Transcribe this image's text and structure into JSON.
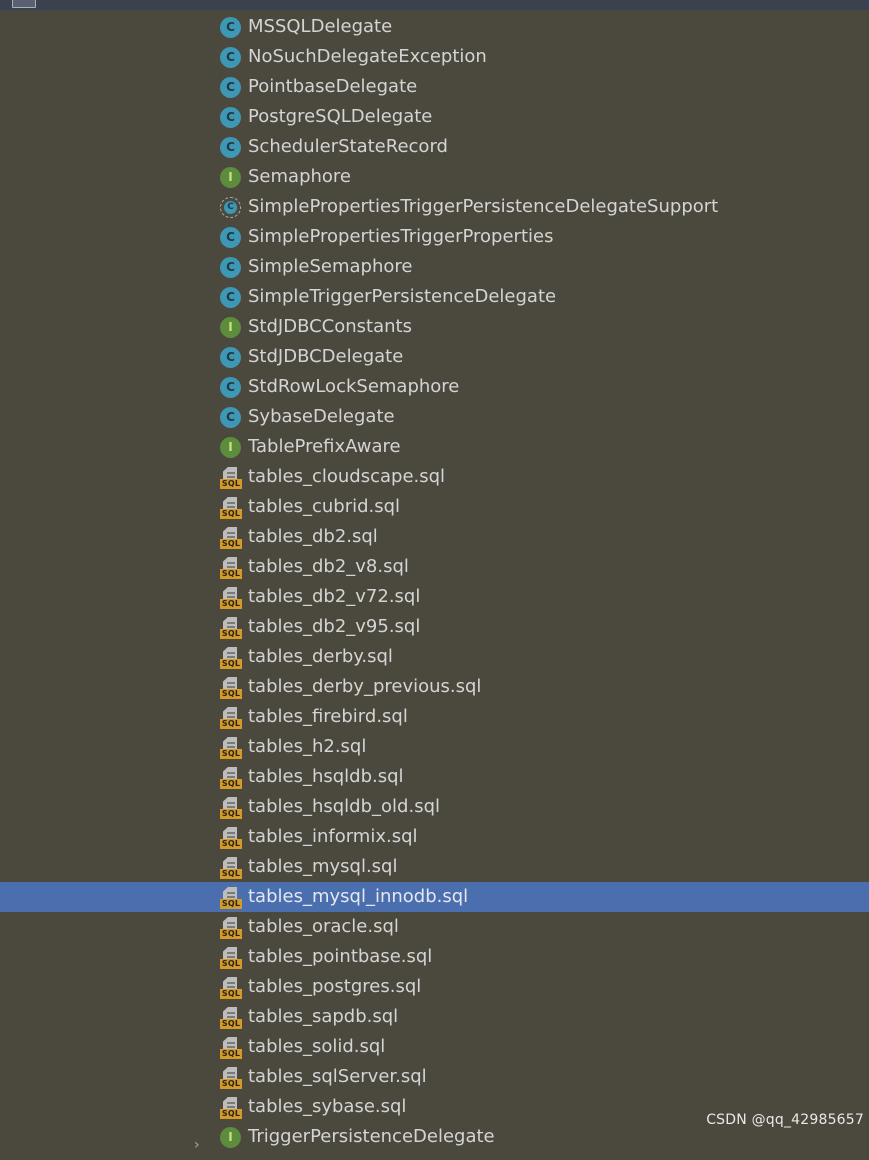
{
  "tree": {
    "items": [
      {
        "label": "MSSQLDelegate",
        "type": "class",
        "icon": "class-icon"
      },
      {
        "label": "NoSuchDelegateException",
        "type": "class",
        "icon": "class-icon"
      },
      {
        "label": "PointbaseDelegate",
        "type": "class",
        "icon": "class-icon"
      },
      {
        "label": "PostgreSQLDelegate",
        "type": "class",
        "icon": "class-icon"
      },
      {
        "label": "SchedulerStateRecord",
        "type": "class",
        "icon": "class-icon"
      },
      {
        "label": "Semaphore",
        "type": "interface",
        "icon": "interface-icon"
      },
      {
        "label": "SimplePropertiesTriggerPersistenceDelegateSupport",
        "type": "abstract",
        "icon": "abstract-class-icon"
      },
      {
        "label": "SimplePropertiesTriggerProperties",
        "type": "class",
        "icon": "class-icon"
      },
      {
        "label": "SimpleSemaphore",
        "type": "class",
        "icon": "class-icon"
      },
      {
        "label": "SimpleTriggerPersistenceDelegate",
        "type": "class",
        "icon": "class-icon"
      },
      {
        "label": "StdJDBCConstants",
        "type": "interface",
        "icon": "interface-icon"
      },
      {
        "label": "StdJDBCDelegate",
        "type": "class",
        "icon": "class-icon"
      },
      {
        "label": "StdRowLockSemaphore",
        "type": "class",
        "icon": "class-icon"
      },
      {
        "label": "SybaseDelegate",
        "type": "class",
        "icon": "class-icon"
      },
      {
        "label": "TablePrefixAware",
        "type": "interface",
        "icon": "interface-icon"
      },
      {
        "label": "tables_cloudscape.sql",
        "type": "sql",
        "icon": "sql-file-icon"
      },
      {
        "label": "tables_cubrid.sql",
        "type": "sql",
        "icon": "sql-file-icon"
      },
      {
        "label": "tables_db2.sql",
        "type": "sql",
        "icon": "sql-file-icon"
      },
      {
        "label": "tables_db2_v8.sql",
        "type": "sql",
        "icon": "sql-file-icon"
      },
      {
        "label": "tables_db2_v72.sql",
        "type": "sql",
        "icon": "sql-file-icon"
      },
      {
        "label": "tables_db2_v95.sql",
        "type": "sql",
        "icon": "sql-file-icon"
      },
      {
        "label": "tables_derby.sql",
        "type": "sql",
        "icon": "sql-file-icon"
      },
      {
        "label": "tables_derby_previous.sql",
        "type": "sql",
        "icon": "sql-file-icon"
      },
      {
        "label": "tables_firebird.sql",
        "type": "sql",
        "icon": "sql-file-icon"
      },
      {
        "label": "tables_h2.sql",
        "type": "sql",
        "icon": "sql-file-icon"
      },
      {
        "label": "tables_hsqldb.sql",
        "type": "sql",
        "icon": "sql-file-icon"
      },
      {
        "label": "tables_hsqldb_old.sql",
        "type": "sql",
        "icon": "sql-file-icon"
      },
      {
        "label": "tables_informix.sql",
        "type": "sql",
        "icon": "sql-file-icon"
      },
      {
        "label": "tables_mysql.sql",
        "type": "sql",
        "icon": "sql-file-icon"
      },
      {
        "label": "tables_mysql_innodb.sql",
        "type": "sql",
        "icon": "sql-file-icon",
        "selected": true
      },
      {
        "label": "tables_oracle.sql",
        "type": "sql",
        "icon": "sql-file-icon"
      },
      {
        "label": "tables_pointbase.sql",
        "type": "sql",
        "icon": "sql-file-icon"
      },
      {
        "label": "tables_postgres.sql",
        "type": "sql",
        "icon": "sql-file-icon"
      },
      {
        "label": "tables_sapdb.sql",
        "type": "sql",
        "icon": "sql-file-icon"
      },
      {
        "label": "tables_solid.sql",
        "type": "sql",
        "icon": "sql-file-icon"
      },
      {
        "label": "tables_sqlServer.sql",
        "type": "sql",
        "icon": "sql-file-icon"
      },
      {
        "label": "tables_sybase.sql",
        "type": "sql",
        "icon": "sql-file-icon"
      },
      {
        "label": "TriggerPersistenceDelegate",
        "type": "interface",
        "icon": "interface-icon",
        "collapsed": true
      }
    ]
  },
  "icon_letters": {
    "class": "C",
    "interface": "I",
    "sql": "SQL"
  },
  "colors": {
    "background": "#4b493e",
    "selection": "#4b6eaf",
    "class_icon": "#3e97b4",
    "interface_icon": "#5c8c3c",
    "sql_tag": "#d49a2a"
  },
  "watermark": "CSDN @qq_42985657"
}
